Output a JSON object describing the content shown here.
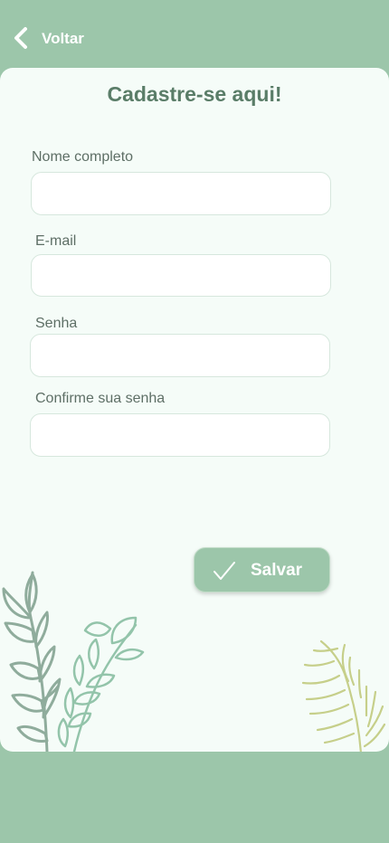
{
  "header": {
    "back_label": "Voltar"
  },
  "form": {
    "title": "Cadastre-se aqui!",
    "fields": [
      {
        "label": "Nome completo",
        "value": "",
        "placeholder": ""
      },
      {
        "label": "E-mail",
        "value": "",
        "placeholder": ""
      },
      {
        "label": "Senha",
        "value": "",
        "placeholder": ""
      },
      {
        "label": "Confirme sua senha",
        "value": "",
        "placeholder": ""
      }
    ],
    "save_label": "Salvar"
  },
  "colors": {
    "background": "#9cc6aa",
    "card": "#f5fcf8",
    "title": "#5a7d68",
    "label": "#5e6f66",
    "button": "#9cc6aa",
    "leaf_gray_green": "#8fac9c",
    "leaf_mint": "#93c4aa",
    "leaf_yellow_green": "#c6cf8a"
  },
  "icons": {
    "back": "chevron-left-icon",
    "save": "check-icon",
    "decoration_left": "leaf-branch-icon",
    "decoration_right": "palm-leaf-icon"
  }
}
